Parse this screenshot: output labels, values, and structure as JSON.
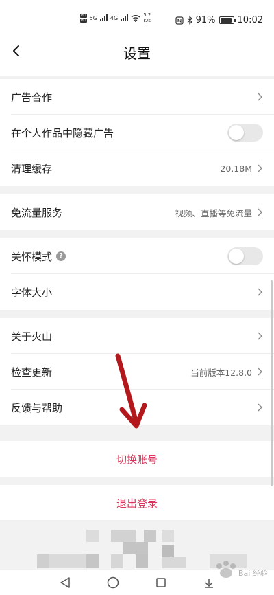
{
  "status_bar": {
    "network_badges": [
      "HD",
      "HD"
    ],
    "signal_labels": [
      "5G",
      "4G"
    ],
    "net_speed": "5.2",
    "net_speed_unit": "K/s",
    "battery": "91%",
    "time": "10:02",
    "battery_level": 0.91
  },
  "header": {
    "title": "设置"
  },
  "settings": {
    "ad_cooperation": {
      "label": "广告合作"
    },
    "hide_ads": {
      "label": "在个人作品中隐藏广告",
      "on": false
    },
    "clear_cache": {
      "label": "清理缓存",
      "value": "20.18M"
    },
    "free_data": {
      "label": "免流量服务",
      "value": "视频、直播等免流量"
    },
    "care_mode": {
      "label": "关怀模式",
      "help_symbol": "?",
      "on": false
    },
    "font_size": {
      "label": "字体大小"
    },
    "about": {
      "label": "关于火山"
    },
    "check_update": {
      "label": "检查更新",
      "value": "当前版本12.8.0"
    },
    "feedback": {
      "label": "反馈与帮助"
    }
  },
  "actions": {
    "switch_account": "切换账号",
    "logout": "退出登录"
  },
  "colors": {
    "accent": "#d9345a",
    "annotation_arrow": "#b3191c",
    "toggle_off": "#e8e8e8",
    "section_gap": "#f2f2f2"
  },
  "watermark": {
    "text": "Bai 经验"
  }
}
